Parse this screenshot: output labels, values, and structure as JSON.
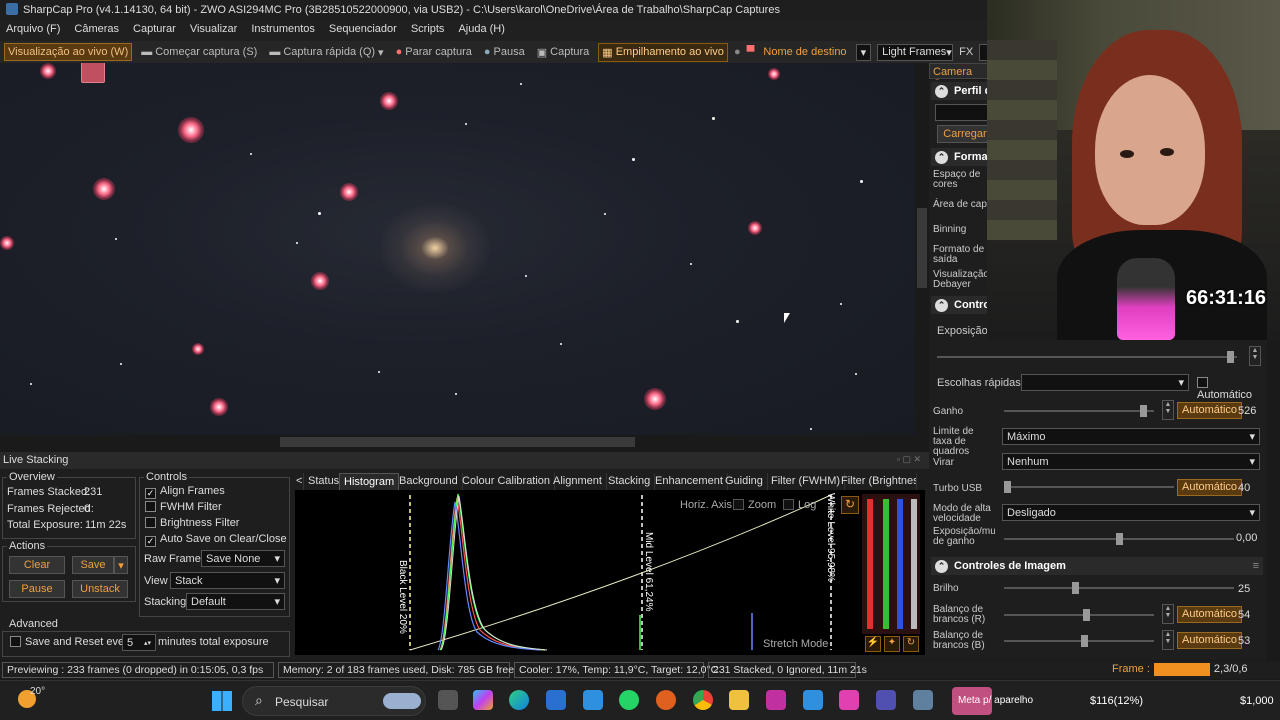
{
  "window": {
    "title": "SharpCap Pro (v4.1.14130, 64 bit) - ZWO ASI294MC Pro (3B28510522000900, via USB2) - C:\\Users\\karol\\OneDrive\\Área de Trabalho\\SharpCap Captures"
  },
  "menu": [
    "Arquivo (F)",
    "Câmeras",
    "Capturar",
    "Visualizar",
    "Instrumentos",
    "Sequenciador",
    "Scripts",
    "Ajuda (H)"
  ],
  "toolbar": {
    "live_view": "Visualização ao vivo (W)",
    "start_capture": "Começar captura (S)",
    "quick_capture": "Captura rápida (Q)",
    "stop_capture": "Parar captura",
    "pause": "Pausa",
    "capture": "Captura",
    "live_stack": "Empilhamento ao vivo",
    "target_name": "Nome de destino",
    "target_value": "",
    "frame_type": "Light Frames",
    "fx": "FX"
  },
  "camera_panel": {
    "header": "Camera Con",
    "profile_title": "Perfil d",
    "load_button": "Carregar",
    "format_title": "Formato",
    "color_space": "Espaço de cores",
    "capture_area": "Área de capt",
    "binning": "Binning",
    "output_format": "Formato de saída",
    "debayer_preview": "Visualização Debayer",
    "controls_title": "Control",
    "exposure_label": "Exposição",
    "quick_picks_label": "Escolhas rápidas",
    "auto_label": "Automático",
    "gain_label": "Ganho",
    "gain_auto": "Automático",
    "gain_value": "526",
    "frame_rate_label": "Limite de taxa de quadros",
    "frame_rate_value": "Máximo",
    "flip_label": "Virar",
    "flip_value": "Nenhum",
    "usb_turbo_label": "Turbo USB",
    "usb_turbo_auto": "Automático",
    "usb_turbo_value": "40",
    "high_speed_label": "Modo de alta velocidade",
    "high_speed_value": "Desligado",
    "exposure_change_label": "Exposição/mudança de ganho",
    "exposure_change_value": "0,00",
    "image_controls_title": "Controles de Imagem",
    "brightness_label": "Brilho",
    "brightness_value": "25",
    "wb_red_label": "Balanço de brancos (R)",
    "wb_red_auto": "Automático",
    "wb_red_value": "54",
    "wb_blue_label": "Balanço de brancos (B)",
    "wb_blue_auto": "Automático",
    "wb_blue_value": "53"
  },
  "timer": "66:31:16",
  "live_stacking": {
    "header": "Live Stacking",
    "overview_title": "Overview",
    "frames_stacked_label": "Frames Stacked:",
    "frames_stacked": "231",
    "frames_rejected_label": "Frames Rejected:",
    "frames_rejected": "0",
    "total_exposure_label": "Total Exposure:",
    "total_exposure": "11m 22s",
    "actions_title": "Actions",
    "clear": "Clear",
    "save": "Save",
    "pause": "Pause",
    "unstack": "Unstack",
    "advanced_title": "Advanced",
    "save_reset_label": "Save and Reset every",
    "save_reset_value": "5",
    "save_reset_suffix": "minutes total exposure",
    "controls_title": "Controls",
    "align_frames": "Align Frames",
    "fwhm_filter": "FWHM Filter",
    "brightness_filter": "Brightness Filter",
    "auto_save": "Auto Save on Clear/Close",
    "raw_frames_label": "Raw Frames",
    "raw_frames_value": "Save None",
    "view_label": "View",
    "view_value": "Stack",
    "stacking_label": "Stacking",
    "stacking_value": "Default",
    "tabs": [
      "Status",
      "Histogram",
      "Background",
      "Colour Calibration",
      "Alignment",
      "Stacking",
      "Enhancement",
      "Guiding",
      "Filter (FWHM)",
      "Filter (Brightness)"
    ],
    "horiz_axis": "Horiz. Axis:",
    "zoom": "Zoom",
    "log": "Log",
    "black_level": "Black Level 20%",
    "mid_level": "Mid Level 61,24%",
    "white_level": "White Level 95,98%",
    "stretch_mode": "Stretch Mode"
  },
  "status": {
    "previewing": "Previewing : 233 frames (0 dropped) in 0:15:05, 0,3 fps",
    "memory": "Memory: 2 of 183 frames used, Disk: 785 GB free",
    "cooler": "Cooler: 17%, Temp: 11,9°C, Target: 12,0°C",
    "stacked": "231 Stacked, 0 Ignored, 11m 21s",
    "frame_label": "Frame :",
    "frame_value": "2,3/0,6"
  },
  "taskbar": {
    "weather": "20°",
    "search": "Pesquisar",
    "meta": "Meta p/ aparelho",
    "ticker1": "$116(12%)",
    "ticker2": "$1,000"
  }
}
